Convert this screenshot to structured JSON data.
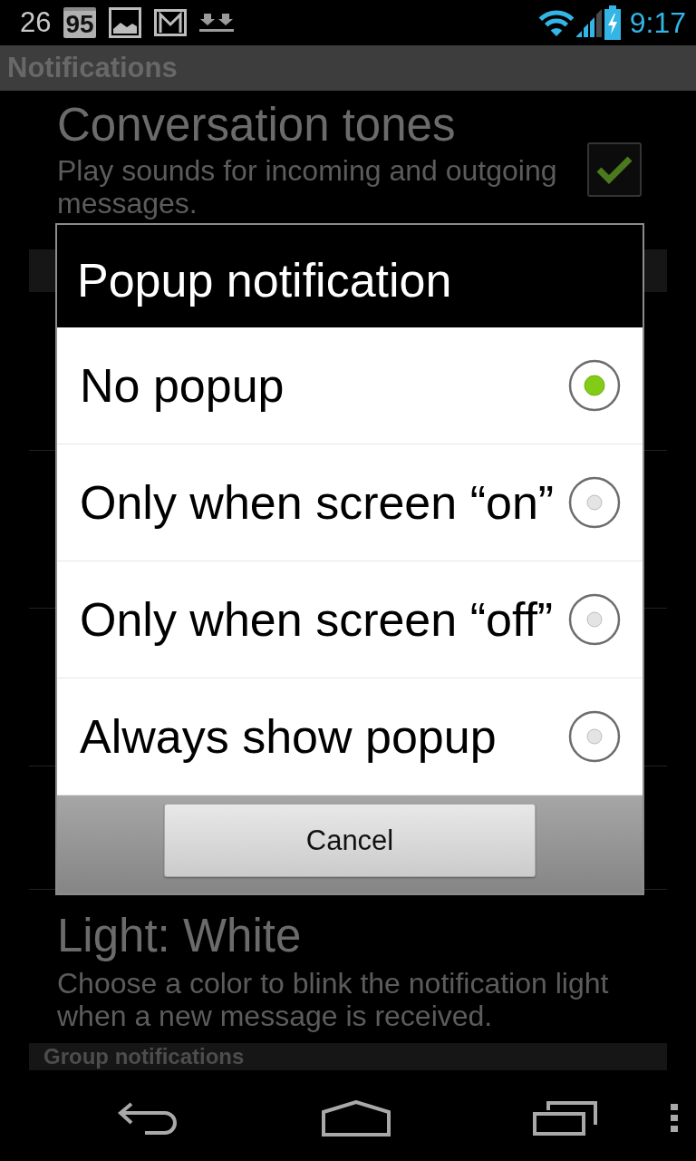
{
  "status_bar": {
    "count": "26",
    "badge": "95",
    "time": "9:17"
  },
  "action_bar": {
    "title": "Notifications"
  },
  "settings_top": [
    {
      "kind": "checkbox",
      "title": "Conversation tones",
      "summary": "Play sounds for incoming and outgoing messages.",
      "checked": true
    },
    {
      "kind": "header"
    }
  ],
  "settings_bottom": [
    {
      "kind": "text",
      "title": "Light: White",
      "summary": "Choose a color to blink the notification light when a new message is received."
    },
    {
      "kind": "header",
      "title": "Group notifications"
    }
  ],
  "dialog": {
    "title": "Popup notification",
    "options": [
      {
        "label": "No popup",
        "selected": true
      },
      {
        "label": "Only when screen “on”",
        "selected": false
      },
      {
        "label": "Only when screen “off”",
        "selected": false
      },
      {
        "label": "Always show popup",
        "selected": false
      }
    ],
    "buttons": [
      "Cancel"
    ]
  }
}
